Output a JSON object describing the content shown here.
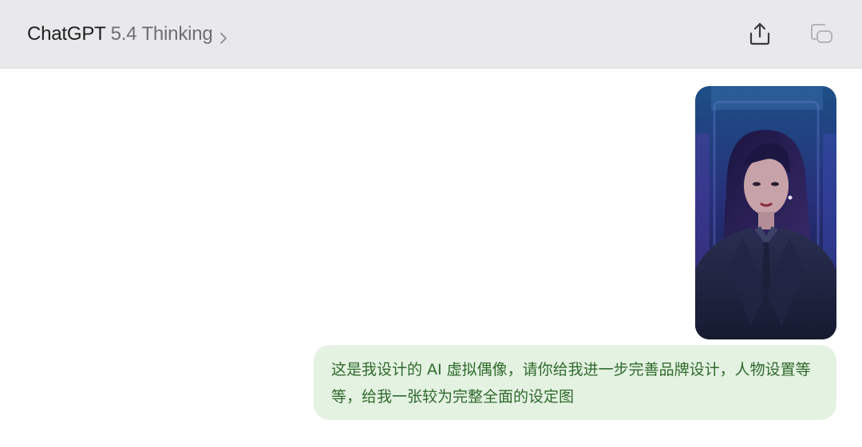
{
  "header": {
    "model_name": "ChatGPT",
    "model_version": "5.4 Thinking",
    "chevron_icon": "chevron-right-icon",
    "share_icon": "share-upload-icon",
    "newchat_icon": "new-chat-icon"
  },
  "conversation": {
    "user_message": {
      "image_alt": "AI virtual idol portrait",
      "text": "这是我设计的 AI 虚拟偶像，请你给我进一步完善品牌设计，人物设置等等，给我一张较为完整全面的设定图"
    }
  },
  "colors": {
    "header_bg": "#e9e9ec",
    "bubble_bg": "#e4f2e2",
    "bubble_text": "#2f6a2c"
  }
}
